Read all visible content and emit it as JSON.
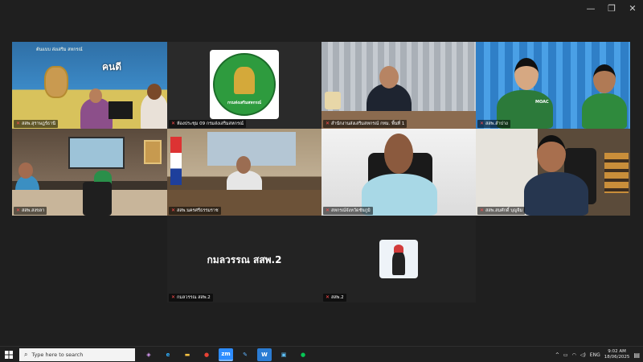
{
  "window": {
    "minimize": "—",
    "restore": "❐",
    "close": "✕"
  },
  "tiles": [
    {
      "id": "t1",
      "label": "สสพ.สุราษฎร์ธานี",
      "sign": "คนดี",
      "sign2": "ต้นแบบ ส่งเสริม สหกรณ์"
    },
    {
      "id": "t2",
      "label": "ห้องประชุม 09 กรมส่งเสริมสหกรณ์",
      "logo_text": "กรมส่งเสริมสหกรณ์"
    },
    {
      "id": "t3",
      "label": "สำนักงานส่งเสริมสหกรณ์ กทม. พื้นที่ 1"
    },
    {
      "id": "t4",
      "label": "สสพ.ลำปาง",
      "shirt_text": "MOAC"
    },
    {
      "id": "t5",
      "label": "สสพ.สงขลา"
    },
    {
      "id": "t6",
      "label": "สสพ.นครศรีธรรมราช"
    },
    {
      "id": "t7",
      "label": "สหกรณ์จังหวัดชัยภูมิ"
    },
    {
      "id": "t8",
      "label": "สสพ.สมศักดิ์ บุญจิม"
    },
    {
      "id": "t9",
      "label": "กมลวรรณ สสพ.2",
      "name_display": "กมลวรรณ  สสพ.2"
    },
    {
      "id": "t10",
      "label": "สสพ.2"
    }
  ],
  "taskbar": {
    "search_placeholder": "Type here to search",
    "apps": [
      {
        "name": "copilot",
        "glyph": "◈",
        "color": "#e0a0ff"
      },
      {
        "name": "edge",
        "glyph": "e",
        "color": "#2fb0ff"
      },
      {
        "name": "file-explorer",
        "glyph": "▬",
        "color": "#f5c242"
      },
      {
        "name": "chrome",
        "glyph": "●",
        "color": "#e94235"
      },
      {
        "name": "zoom",
        "glyph": "zm",
        "color": "#2d8cff"
      },
      {
        "name": "pen",
        "glyph": "✎",
        "color": "#5fb4ff"
      },
      {
        "name": "word",
        "glyph": "W",
        "color": "#2b7cd3"
      },
      {
        "name": "app",
        "glyph": "▣",
        "color": "#5fc3ff"
      },
      {
        "name": "line",
        "glyph": "●",
        "color": "#06c755"
      }
    ],
    "tray": {
      "chevron": "^",
      "lang": "ENG",
      "time": "9:02 AM",
      "date": "18/06/2025"
    }
  }
}
